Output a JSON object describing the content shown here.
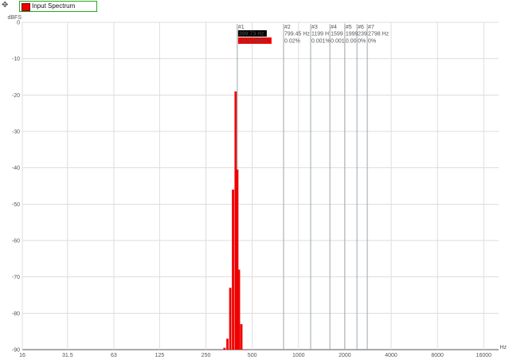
{
  "legend": {
    "label": "Input Spectrum",
    "swatch_color": "#ee0000"
  },
  "toolbar": {
    "corner_icon": "move-icon"
  },
  "chart_data": {
    "type": "bar",
    "ylabel": "dBFS",
    "xlabel": "Hz",
    "xscale": "log",
    "xlim": [
      16,
      20000
    ],
    "ylim": [
      -90,
      0
    ],
    "y_ticks": [
      0,
      -10,
      -20,
      -30,
      -40,
      -50,
      -60,
      -70,
      -80,
      -90
    ],
    "x_ticks": [
      16,
      31.5,
      63,
      125,
      250,
      500,
      1000,
      2000,
      4000,
      8000,
      16000
    ],
    "x_tick_labels": [
      "16",
      "31.5",
      "63",
      "125",
      "250",
      "500",
      "1000",
      "2000",
      "4000",
      "8000",
      "16000"
    ],
    "grid": true,
    "bar_color": "#ee0000",
    "series": [
      {
        "x": [
          330,
          345,
          360,
          375,
          390,
          400,
          410,
          425,
          440,
          455
        ],
        "values": [
          -89.5,
          -87,
          -73,
          -46,
          -19,
          -40.5,
          -68,
          -83,
          -90,
          -90
        ]
      }
    ],
    "markers": [
      {
        "id": "#1",
        "freq": 399.73,
        "freq_label": "399.73 Hz",
        "level_label": "-18.8 dBFS",
        "highlight": true
      },
      {
        "id": "#2",
        "freq": 799.45,
        "freq_label": "799.45 Hz",
        "level_label": "0.02%"
      },
      {
        "id": "#3",
        "freq": 1199,
        "freq_label": "1199 H",
        "level_label": "0.001%"
      },
      {
        "id": "#4",
        "freq": 1599,
        "freq_label": "1599",
        "level_label": "0.001"
      },
      {
        "id": "#5",
        "freq": 1999,
        "freq_label": "1999",
        "level_label": "0.00"
      },
      {
        "id": "#6",
        "freq": 2398,
        "freq_label": "239",
        "level_label": "0%"
      },
      {
        "id": "#7",
        "freq": 2798,
        "freq_label": "2798 Hz",
        "level_label": "0%"
      }
    ]
  }
}
